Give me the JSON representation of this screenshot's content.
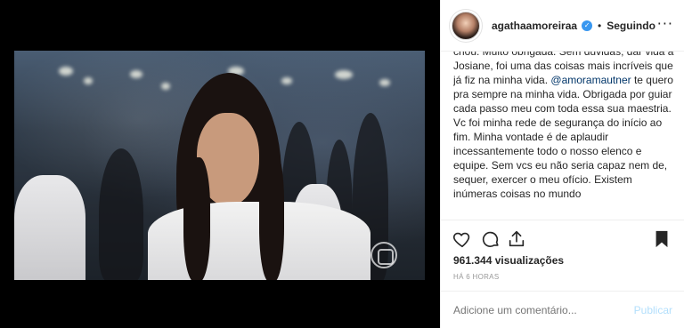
{
  "post": {
    "username": "agathaamoreiraa",
    "separator": "•",
    "follow_label": "Seguindo",
    "caption_before_mention": "criou. Muito obrigada. Sem dúvidas, dar vida a Josiane, foi uma das coisas mais incríveis que já fiz na minha vida. ",
    "mention": "@amoramautner",
    "caption_after_mention": " te quero pra sempre na minha vida. Obrigada por guiar cada passo meu com toda essa sua maestria. Vc foi minha rede de segurança do início ao fim. Minha vontade é de aplaudir incessantemente todo o nosso elenco e equipe. Sem vcs eu não seria capaz nem de, sequer, exercer o meu ofício. Existem inúmeras coisas no mundo",
    "views": "961.344 visualizações",
    "time": "HÁ 6 HORAS",
    "comment_placeholder": "Adicione um comentário...",
    "publish_label": "Publicar"
  },
  "icons": {
    "verified": "verified-badge-icon",
    "more": "more-options-icon",
    "like": "heart-icon",
    "comment": "comment-icon",
    "share": "share-icon",
    "save": "bookmark-icon"
  },
  "colors": {
    "verified_blue": "#3897f0",
    "publish_disabled": "#b2dffc",
    "mention": "#003569"
  }
}
